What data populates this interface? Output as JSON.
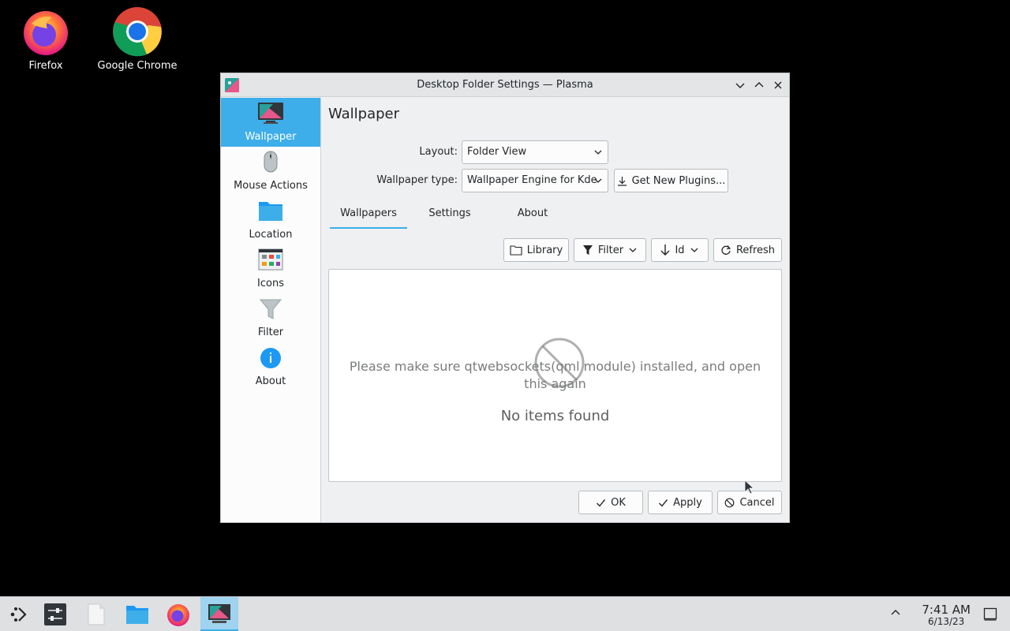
{
  "desktop": {
    "icons": [
      {
        "label": "Firefox"
      },
      {
        "label": "Google Chrome"
      }
    ]
  },
  "window": {
    "title": "Desktop Folder Settings — Plasma",
    "sidebar": {
      "items": [
        {
          "label": "Wallpaper",
          "active": true
        },
        {
          "label": "Mouse Actions"
        },
        {
          "label": "Location"
        },
        {
          "label": "Icons"
        },
        {
          "label": "Filter"
        },
        {
          "label": "About"
        }
      ]
    },
    "page_title": "Wallpaper",
    "layout": {
      "label": "Layout:",
      "value": "Folder View"
    },
    "wallpaper_type": {
      "label": "Wallpaper type:",
      "value": "Wallpaper Engine for Kde"
    },
    "get_new_plugins": "Get New Plugins...",
    "tabs": [
      {
        "label": "Wallpapers",
        "active": true
      },
      {
        "label": "Settings"
      },
      {
        "label": "About"
      }
    ],
    "toolbar": {
      "library": "Library",
      "filter": "Filter",
      "sort": "Id",
      "refresh": "Refresh"
    },
    "empty": {
      "message": "Please make sure qtwebsockets(qml module) installed, and open this again",
      "title": "No items found"
    },
    "buttons": {
      "ok": "OK",
      "apply": "Apply",
      "cancel": "Cancel"
    }
  },
  "taskbar": {
    "time": "7:41 AM",
    "date": "6/13/23"
  },
  "colors": {
    "accent": "#3daee9",
    "window_bg": "#eff0f1"
  }
}
